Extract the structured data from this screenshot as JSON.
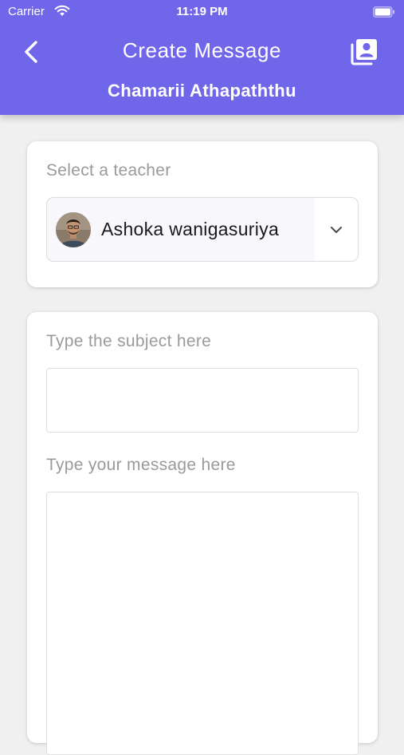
{
  "status_bar": {
    "carrier": "Carrier",
    "time": "11:19 PM"
  },
  "header": {
    "title": "Create Message",
    "subtitle": "Chamarii Athapaththu",
    "back_icon": "chevron-left-icon",
    "contacts_icon": "contacts-book-icon",
    "background_color": "#7066ea"
  },
  "teacher_section": {
    "label": "Select a teacher",
    "selected_teacher": "Ashoka wanigasuriya",
    "dropdown_icon": "chevron-down-icon"
  },
  "message_section": {
    "subject_label": "Type the subject here",
    "subject_value": "",
    "message_label": "Type your message here",
    "message_value": ""
  }
}
